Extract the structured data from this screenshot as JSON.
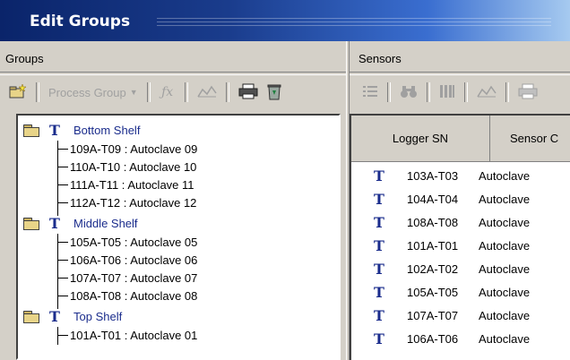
{
  "window": {
    "title": "Edit Groups"
  },
  "groups_panel": {
    "header": "Groups",
    "toolbar": {
      "process_group_label": "Process Group"
    },
    "groups": [
      {
        "label": "Bottom Shelf",
        "children": [
          "109A-T09 : Autoclave 09",
          "110A-T10 : Autoclave 10",
          "111A-T11 : Autoclave 11",
          "112A-T12 : Autoclave 12"
        ]
      },
      {
        "label": "Middle Shelf",
        "children": [
          "105A-T05 : Autoclave 05",
          "106A-T06 : Autoclave 06",
          "107A-T07 : Autoclave 07",
          "108A-T08 : Autoclave 08"
        ]
      },
      {
        "label": "Top Shelf",
        "children": [
          "101A-T01 : Autoclave 01"
        ]
      }
    ]
  },
  "sensors_panel": {
    "header": "Sensors",
    "columns": [
      "Logger SN",
      "Sensor C"
    ],
    "rows": [
      {
        "sn": "103A-T03",
        "desc": "Autoclave"
      },
      {
        "sn": "104A-T04",
        "desc": "Autoclave"
      },
      {
        "sn": "108A-T08",
        "desc": "Autoclave"
      },
      {
        "sn": "101A-T01",
        "desc": "Autoclave"
      },
      {
        "sn": "102A-T02",
        "desc": "Autoclave"
      },
      {
        "sn": "105A-T05",
        "desc": "Autoclave"
      },
      {
        "sn": "107A-T07",
        "desc": "Autoclave"
      },
      {
        "sn": "106A-T06",
        "desc": "Autoclave"
      }
    ]
  },
  "colors": {
    "title_bar": "#0a246a",
    "tree_accent": "#1a2c8c",
    "face": "#d4d0c8"
  }
}
